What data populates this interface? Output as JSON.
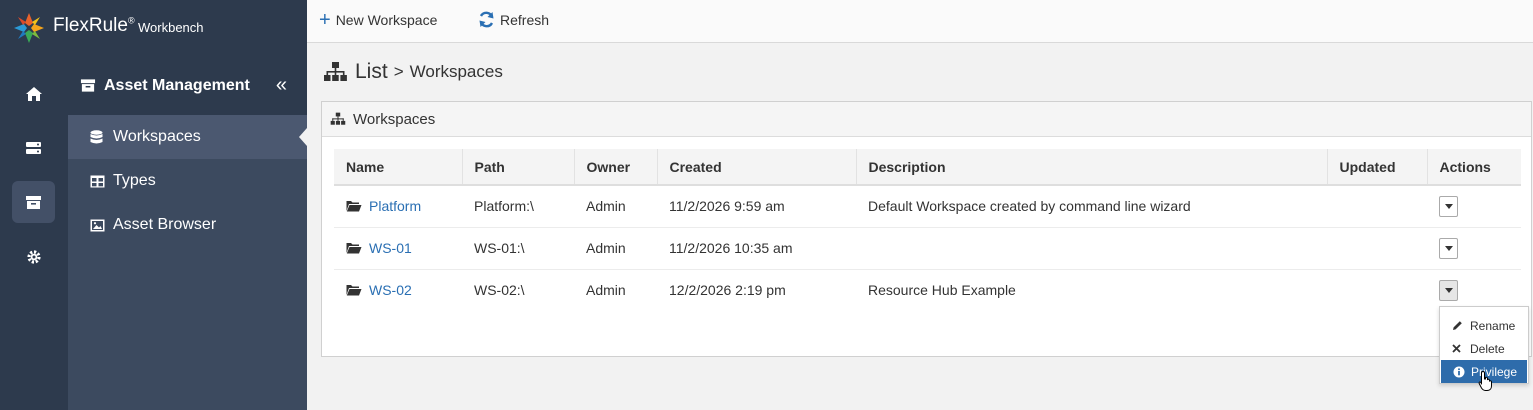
{
  "app": {
    "brand": "FlexRule",
    "brand_mark": "®",
    "product": "Workbench"
  },
  "toolbar": {
    "new_workspace": "New Workspace",
    "refresh": "Refresh"
  },
  "sidebar": {
    "section_title": "Asset Management",
    "items": [
      {
        "label": "Workspaces",
        "icon": "database-icon",
        "active": true
      },
      {
        "label": "Types",
        "icon": "table-icon",
        "active": false
      },
      {
        "label": "Asset Browser",
        "icon": "image-icon",
        "active": false
      }
    ]
  },
  "iconbar": {
    "items": [
      "home-icon",
      "server-icon",
      "archive-icon",
      "gear-icon"
    ]
  },
  "breadcrumb": {
    "root": "List",
    "separator": ">",
    "current": "Workspaces"
  },
  "panel": {
    "title": "Workspaces"
  },
  "table": {
    "columns": [
      "Name",
      "Path",
      "Owner",
      "Created",
      "Description",
      "Updated",
      "Actions"
    ],
    "rows": [
      {
        "name": "Platform",
        "path": "Platform:\\",
        "owner": "Admin",
        "created": "11/2/2026 9:59 am",
        "description": "Default Workspace created by command line wizard",
        "updated": ""
      },
      {
        "name": "WS-01",
        "path": "WS-01:\\",
        "owner": "Admin",
        "created": "11/2/2026 10:35 am",
        "description": "",
        "updated": ""
      },
      {
        "name": "WS-02",
        "path": "WS-02:\\",
        "owner": "Admin",
        "created": "12/2/2026 2:19 pm",
        "description": "Resource Hub Example",
        "updated": ""
      }
    ]
  },
  "actions_menu": {
    "rename": "Rename",
    "delete": "Delete",
    "privilege": "Privilege"
  },
  "colors": {
    "sidebar_dark": "#2d3a4d",
    "sidebar": "#3c4a5f",
    "accent": "#2a6fb3",
    "menu_highlight": "#2e6cab"
  }
}
